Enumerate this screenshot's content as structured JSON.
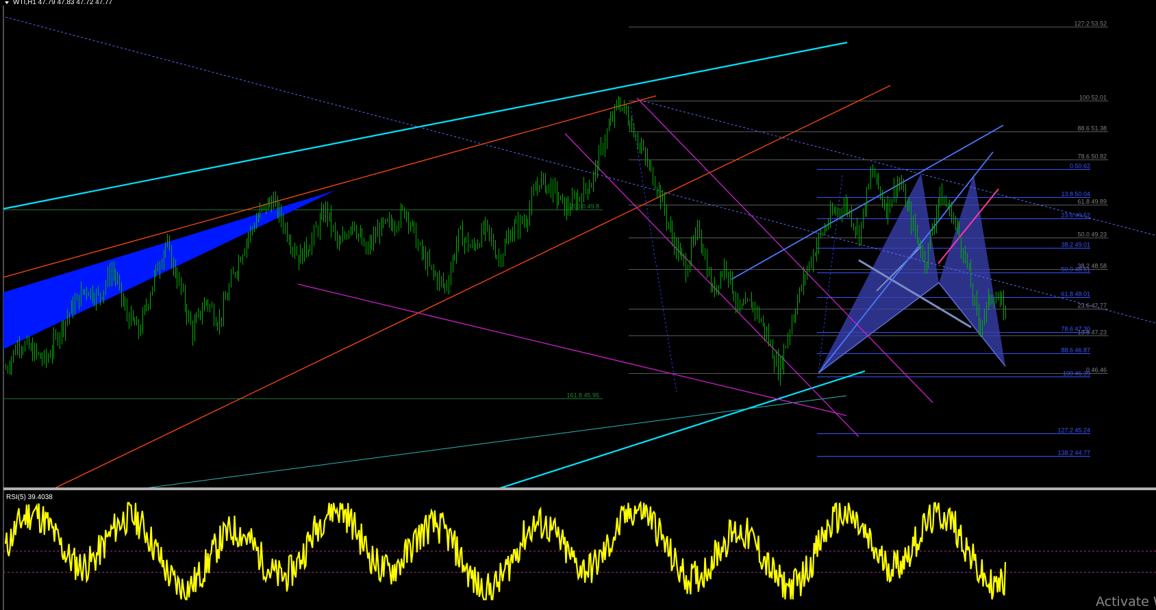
{
  "header": {
    "symbol_text": "WTI,H1  47.79 47.83 47.72 47.77",
    "menu_arrow_icon": "triangle-down-icon"
  },
  "rsi_panel": {
    "label": "RSI(5) 39.4038"
  },
  "watermark": {
    "text": "Activate W"
  },
  "colors": {
    "background": "#000000",
    "candles": "#00b000",
    "cyan_channel": "#00e5ff",
    "orange_channel": "#ff4a10",
    "magenta_lines": "#d020d0",
    "blue_wedge": "#0018ff",
    "pattern_fill": "#3a40b0",
    "fib_green": "#1f6e3a",
    "fib_gray": "#808080",
    "fib_blue": "#3a55ff",
    "rsi_line": "#ffff00",
    "rsi_levels": "#b03090",
    "panel_separator": "#b0b0b0"
  },
  "chart_data": [
    {
      "type": "candlestick",
      "symbol": "WTI",
      "timeframe": "H1",
      "ohlc_last": {
        "open": 47.79,
        "high": 47.83,
        "low": 47.72,
        "close": 47.77
      },
      "ylim": [
        44.3,
        53.7
      ],
      "price_path": [
        46.55,
        47.1,
        46.9,
        46.7,
        47.3,
        47.8,
        48.2,
        48.0,
        48.6,
        47.7,
        47.3,
        48.3,
        49.1,
        48.3,
        47.3,
        47.95,
        47.5,
        48.4,
        49.15,
        49.7,
        50.0,
        49.4,
        48.8,
        49.2,
        49.8,
        49.0,
        49.6,
        48.9,
        49.4,
        49.5,
        49.8,
        49.0,
        48.5,
        48.2,
        49.3,
        49.0,
        49.4,
        48.8,
        49.4,
        49.6,
        50.4,
        50.2,
        49.8,
        50.05,
        50.4,
        51.3,
        52.0,
        51.5,
        50.8,
        50.2,
        49.2,
        48.6,
        49.4,
        48.1,
        48.7,
        47.7,
        47.9,
        47.3,
        46.5,
        47.6,
        48.5,
        49.2,
        49.7,
        49.9,
        49.3,
        50.6,
        49.8,
        50.4,
        49.5,
        48.7,
        50.1,
        49.7,
        48.8,
        47.4,
        48.1,
        47.7
      ],
      "pattern_points": {
        "X": 46.35,
        "A": 50.62,
        "B": 48.51,
        "C": 50.62,
        "D": 46.87
      },
      "fib_sets": [
        {
          "name": "fib_red_leg",
          "levels": [
            {
              "label": "127.2 53.52"
            },
            {
              "label": "100 52.01"
            },
            {
              "label": "88.6 51.38"
            },
            {
              "label": "78.6 50.82"
            },
            {
              "label": "61.8 49.89"
            },
            {
              "label": "50.0 49.23"
            },
            {
              "label": "38.2 48.58"
            },
            {
              "label": "23.6 47.77"
            },
            {
              "label": "13.8 47.23"
            },
            {
              "label": "0 46.46"
            }
          ]
        },
        {
          "name": "fib_blue_pattern",
          "levels": [
            {
              "label": "0 50.62"
            },
            {
              "label": "13.8 50.04"
            },
            {
              "label": "23.6 49.62"
            },
            {
              "label": "38.2 49.01"
            },
            {
              "label": "50.0 48.51"
            },
            {
              "label": "61.8 48.01"
            },
            {
              "label": "78.6 47.30"
            },
            {
              "label": "88.6 46.87"
            },
            {
              "label": "100 46.39"
            },
            {
              "label": "127.2 45.24"
            },
            {
              "label": "138.2 44.77"
            }
          ]
        },
        {
          "name": "fib_green_ext",
          "levels": [
            {
              "label": "200.0 49.8"
            },
            {
              "label": "161.8 45.95"
            }
          ]
        }
      ]
    },
    {
      "type": "line",
      "indicator": "RSI",
      "period": 5,
      "current_value": 39.4038,
      "levels": [
        30,
        70
      ],
      "ylim": [
        0,
        100
      ]
    }
  ]
}
